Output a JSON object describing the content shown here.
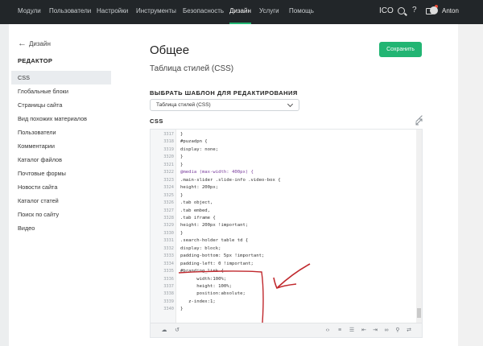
{
  "nav": {
    "items": [
      "Модули",
      "Пользователи",
      "Настройки",
      "Инструменты",
      "Безопасность",
      "Дизайн",
      "Услуги",
      "Помощь"
    ],
    "active_index": 5,
    "ico_label": "ICO",
    "user_name": "Anton",
    "icons": [
      "search-icon",
      "help-icon",
      "gift-icon",
      "avatar-icon"
    ]
  },
  "sidebar": {
    "back_label": "Дизайн",
    "section_title": "РЕДАКТОР",
    "items": [
      "CSS",
      "Глобальные блоки",
      "Страницы сайта",
      "Вид похожих материалов",
      "Пользователи",
      "Комментарии",
      "Каталог файлов",
      "Почтовые формы",
      "Новости сайта",
      "Каталог статей",
      "Поиск по сайту",
      "Видео"
    ],
    "active_index": 0
  },
  "main": {
    "title": "Общее",
    "subtitle": "Таблица стилей (CSS)",
    "save_label": "Сохранить",
    "template_label": "ВЫБРАТЬ ШАБЛОН ДЛЯ РЕДАКТИРОВАНИЯ",
    "template_value": "Таблица стилей (CSS)",
    "css_label": "CSS"
  },
  "editor": {
    "lines": [
      {
        "n": "3317",
        "t": "}"
      },
      {
        "n": "3318",
        "t": "#puzadpn {"
      },
      {
        "n": "3319",
        "t": "display: none;"
      },
      {
        "n": "3320",
        "t": "}"
      },
      {
        "n": "3321",
        "t": "}"
      },
      {
        "n": "3322",
        "t": "@media (max-width: 400px) {"
      },
      {
        "n": "3323",
        "t": ".main-slider .slide-info .video-box {"
      },
      {
        "n": "3324",
        "t": "height: 200px;"
      },
      {
        "n": "3325",
        "t": "}"
      },
      {
        "n": "3326",
        "t": ".tab object,"
      },
      {
        "n": "3327",
        "t": ".tab embed,"
      },
      {
        "n": "3328",
        "t": ".tab iframe {"
      },
      {
        "n": "3329",
        "t": "height: 200px !important;"
      },
      {
        "n": "3330",
        "t": "}"
      },
      {
        "n": "3331",
        "t": ".search-holder table td {"
      },
      {
        "n": "3332",
        "t": "display: block;"
      },
      {
        "n": "3333",
        "t": "padding-bottom: 5px !important;"
      },
      {
        "n": "3334",
        "t": "padding-left: 0 !important;"
      },
      {
        "n": "3335",
        "t": "#branding_link {"
      },
      {
        "n": "3336",
        "t": "      width:100%;"
      },
      {
        "n": "3337",
        "t": "      height: 100%;"
      },
      {
        "n": "3338",
        "t": "      position:absolute;"
      },
      {
        "n": "3339",
        "t": "   z-index:1;"
      },
      {
        "n": "3340",
        "t": "}"
      }
    ],
    "toolbar_icons": [
      "cloud-icon",
      "undo-icon",
      "code-icon",
      "align-icon",
      "list-icon",
      "back-arrow-icon",
      "forward-arrow-icon",
      "link-icon",
      "search-icon",
      "replace-icon",
      "fullscreen-icon"
    ]
  },
  "colors": {
    "topbar": "#222629",
    "accent": "#22b573",
    "annotation": "#c0282d"
  }
}
